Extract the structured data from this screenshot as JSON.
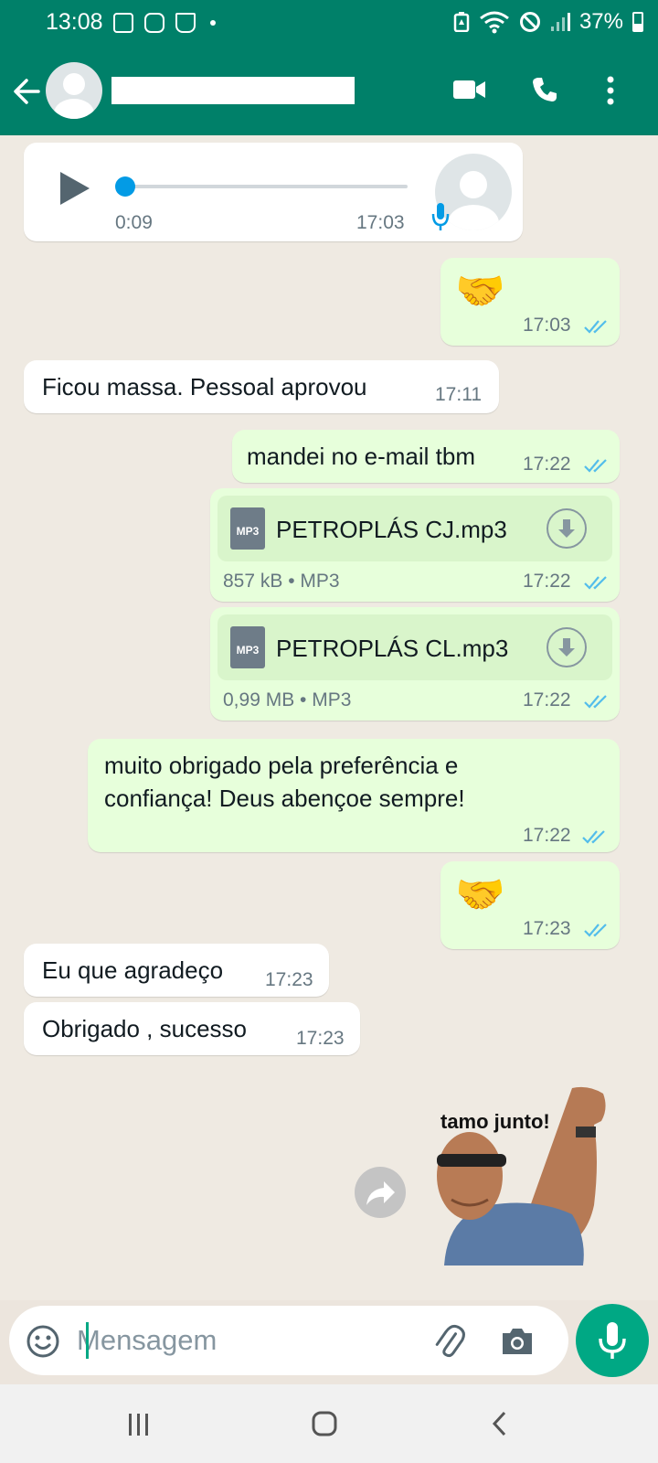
{
  "status_bar": {
    "time": "13:08",
    "battery": "37%",
    "icons": [
      "image-icon",
      "instagram-icon",
      "cup-icon",
      "notification-dot",
      "battery-saver-icon",
      "wifi-icon",
      "do-not-disturb-icon",
      "signal-icon",
      "battery-icon"
    ]
  },
  "header": {
    "back_icon": "arrow-left-icon",
    "contact_name": "",
    "video_call_icon": "video-camera-icon",
    "voice_call_icon": "phone-icon",
    "menu_icon": "more-vertical-icon"
  },
  "messages": {
    "audio": {
      "duration": "0:09",
      "time": "17:03"
    },
    "m1": {
      "text": "🤝",
      "time": "17:03"
    },
    "m2": {
      "text": "Ficou massa. Pessoal aprovou",
      "time": "17:11"
    },
    "m3": {
      "text": "mandei no e-mail tbm",
      "time": "17:22"
    },
    "file1": {
      "icon_label": "MP3",
      "name": "PETROPLÁS CJ.mp3",
      "size": "857 kB",
      "type": "MP3",
      "time": "17:22"
    },
    "file2": {
      "icon_label": "MP3",
      "name": "PETROPLÁS CL.mp3",
      "size": "0,99 MB",
      "type": "MP3",
      "time": "17:22"
    },
    "m4": {
      "line1": "muito obrigado pela preferência e",
      "line2": "confiança! Deus abençoe sempre!",
      "time": "17:22"
    },
    "m5": {
      "text": "🤝",
      "time": "17:23"
    },
    "m6": {
      "text": "Eu que agradeço",
      "time": "17:23"
    },
    "m7": {
      "text": "Obrigado , sucesso",
      "time": "17:23"
    },
    "sticker": {
      "caption": "tamo junto!"
    }
  },
  "meta_sep": " • ",
  "input": {
    "placeholder": "Mensagem",
    "emoji_icon": "emoji-icon",
    "attach_icon": "paperclip-icon",
    "camera_icon": "camera-icon",
    "mic_icon": "microphone-icon"
  },
  "colors": {
    "header": "#008069",
    "outgoing_bubble": "#e7ffdb",
    "incoming_bubble": "#ffffff",
    "accent": "#00a884",
    "read_ticks": "#53bdeb"
  }
}
